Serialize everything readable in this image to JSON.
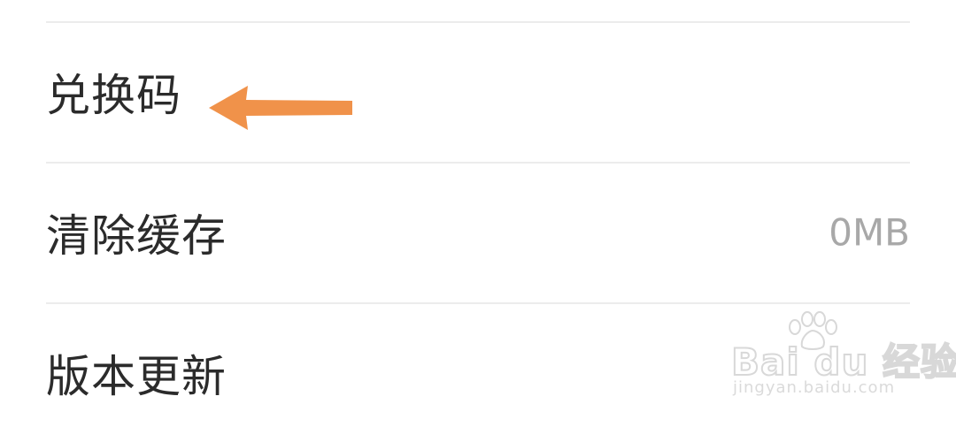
{
  "settings": {
    "items": [
      {
        "label": "兑换码",
        "value": ""
      },
      {
        "label": "清除缓存",
        "value": "0MB"
      },
      {
        "label": "版本更新",
        "value": ""
      }
    ]
  },
  "annotation": {
    "arrow_color": "#f0924a",
    "arrow_icon": "left-arrow-icon"
  },
  "watermark": {
    "logo_text": "Bai du 经验",
    "url": "jingyan.baidu.com"
  },
  "colors": {
    "label": "#2b2b2b",
    "value": "#a8a8a8",
    "divider": "#ececec",
    "background": "#ffffff"
  }
}
